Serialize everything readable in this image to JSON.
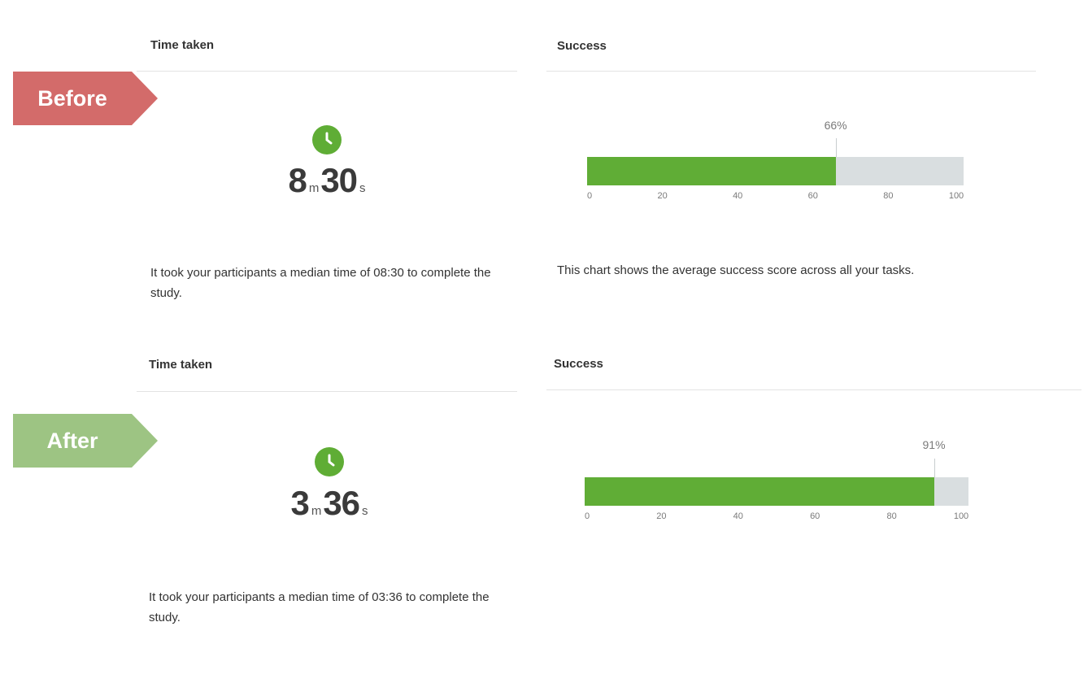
{
  "before": {
    "tag": "Before",
    "time": {
      "title": "Time taken",
      "minutes": "8",
      "seconds": "30",
      "minute_unit": "m",
      "second_unit": "s",
      "description": "It took your participants a median time of 08:30 to complete the study."
    },
    "success": {
      "title": "Success",
      "description": "This chart shows the average success score across all your tasks."
    }
  },
  "after": {
    "tag": "After",
    "time": {
      "title": "Time taken",
      "minutes": "3",
      "seconds": "36",
      "minute_unit": "m",
      "second_unit": "s",
      "description": "It took your participants a median time of 03:36 to complete the study."
    },
    "success": {
      "title": "Success"
    }
  },
  "colors": {
    "before_tag": "#d36b6a",
    "after_tag": "#9dc483",
    "success_fill": "#60ad36",
    "track": "#d9dee0",
    "clock": "#5fad35"
  },
  "icons": [
    "clock-icon"
  ],
  "chart_data": [
    {
      "type": "bar",
      "orientation": "horizontal",
      "values": [
        66
      ],
      "value_label": "66%",
      "xlim": [
        0,
        100
      ],
      "xticks": [
        "0",
        "20",
        "40",
        "60",
        "80",
        "100"
      ]
    },
    {
      "type": "bar",
      "orientation": "horizontal",
      "values": [
        91
      ],
      "value_label": "91%",
      "xlim": [
        0,
        100
      ],
      "xticks": [
        "0",
        "20",
        "40",
        "60",
        "80",
        "100"
      ]
    }
  ]
}
